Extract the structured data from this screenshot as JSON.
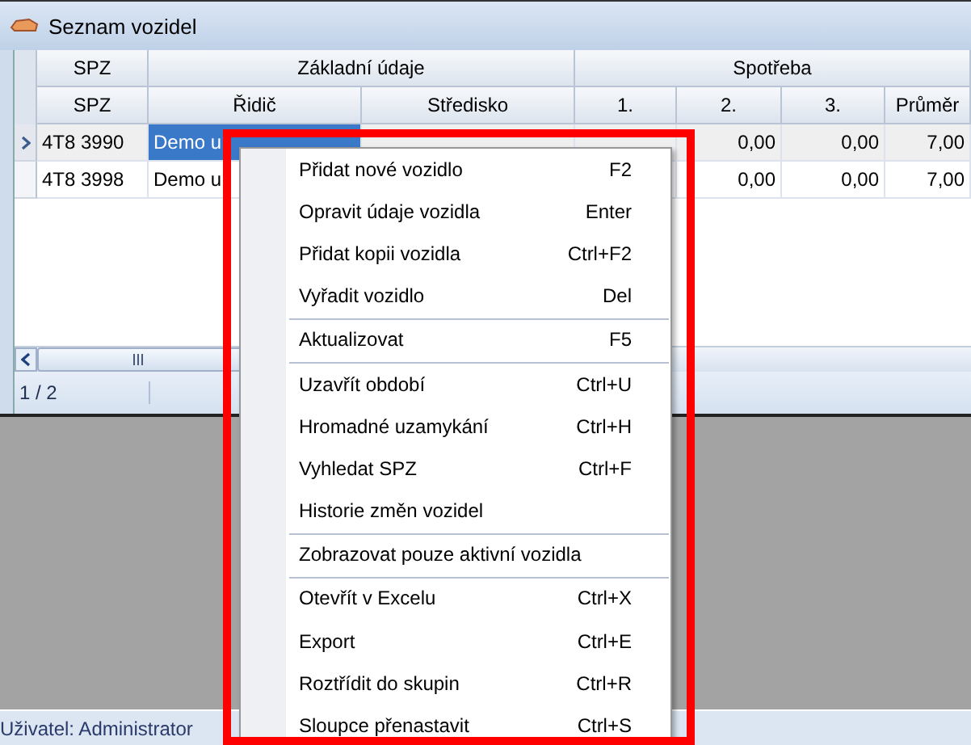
{
  "window": {
    "title": "Seznam vozidel"
  },
  "grid": {
    "group_headers": [
      "SPZ",
      "Základní údaje",
      "Spotřeba"
    ],
    "columns": [
      "SPZ",
      "Řidič",
      "Středisko",
      "1.",
      "2.",
      "3.",
      "Průměr"
    ],
    "rows": [
      {
        "selected": true,
        "cells": [
          "4T8 3990",
          "Demo u",
          null,
          null,
          "0,00",
          "0,00",
          "7,00"
        ]
      },
      {
        "selected": false,
        "cells": [
          "4T8 3998",
          "Demo u",
          null,
          null,
          "0,00",
          "0,00",
          "7,00"
        ]
      }
    ],
    "record_counter": "1 / 2"
  },
  "context_menu": [
    {
      "kind": "item",
      "label": "Přidat nové vozidlo",
      "shortcut": "F2"
    },
    {
      "kind": "item",
      "label": "Opravit údaje vozidla",
      "shortcut": "Enter"
    },
    {
      "kind": "item",
      "label": "Přidat kopii vozidla",
      "shortcut": "Ctrl+F2"
    },
    {
      "kind": "item",
      "label": "Vyřadit vozidlo",
      "shortcut": "Del"
    },
    {
      "kind": "separator"
    },
    {
      "kind": "item",
      "label": "Aktualizovat",
      "shortcut": "F5"
    },
    {
      "kind": "separator"
    },
    {
      "kind": "item",
      "label": "Uzavřít období",
      "shortcut": "Ctrl+U"
    },
    {
      "kind": "item",
      "label": "Hromadné uzamykání",
      "shortcut": "Ctrl+H"
    },
    {
      "kind": "item",
      "label": "Vyhledat SPZ",
      "shortcut": "Ctrl+F"
    },
    {
      "kind": "item",
      "label": "Historie změn vozidel"
    },
    {
      "kind": "separator"
    },
    {
      "kind": "item",
      "label": "Zobrazovat pouze aktivní vozidla"
    },
    {
      "kind": "separator"
    },
    {
      "kind": "item",
      "label": "Otevřít v Excelu",
      "shortcut": "Ctrl+X"
    },
    {
      "kind": "item",
      "label": "Export",
      "shortcut": "Ctrl+E"
    },
    {
      "kind": "item",
      "label": "Roztřídit do skupin",
      "shortcut": "Ctrl+R"
    },
    {
      "kind": "item",
      "label": "Sloupce přenastavit",
      "shortcut": "Ctrl+S"
    }
  ],
  "status_bar": {
    "user": "Uživatel: Administrator"
  }
}
